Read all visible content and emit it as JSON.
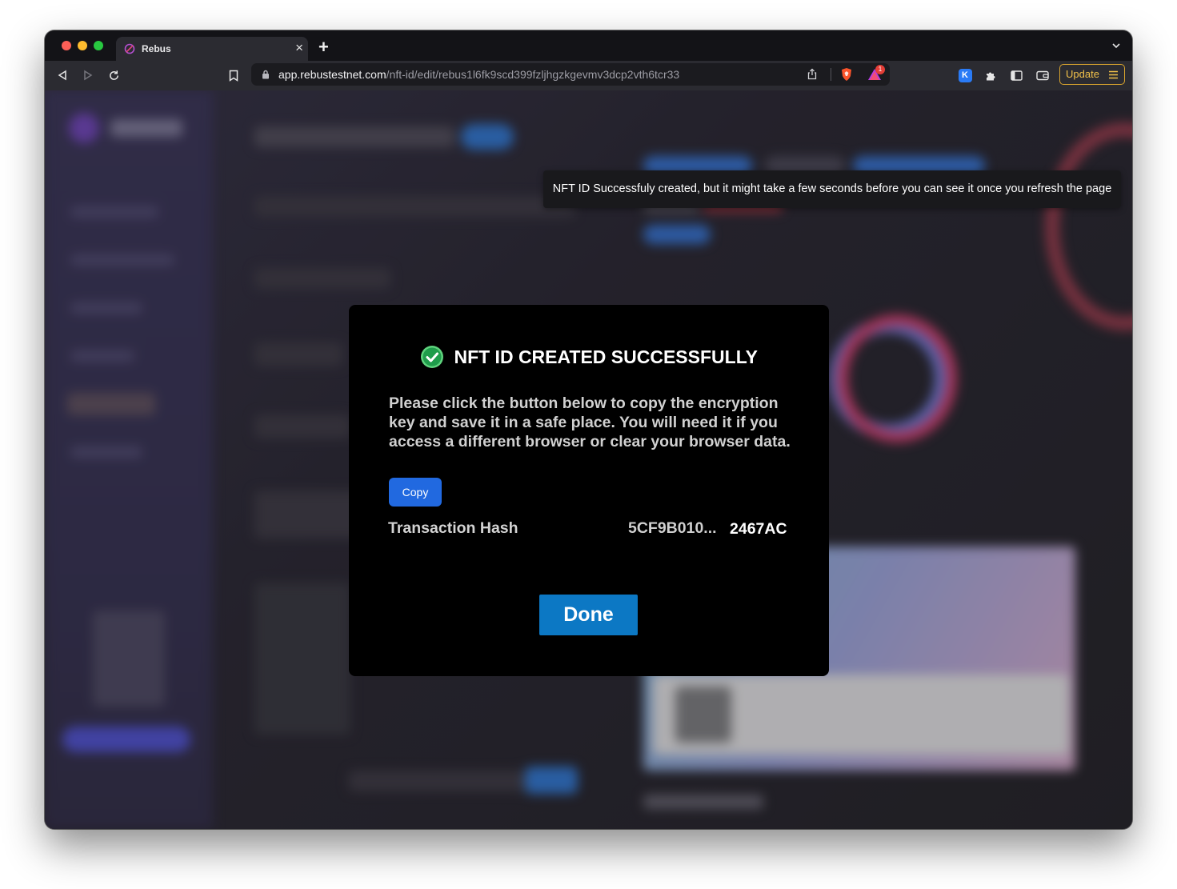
{
  "browser": {
    "tab_title": "Rebus",
    "url_host": "app.rebustestnet.com",
    "url_path": "/nft-id/edit/rebus1l6fk9scd399fzljhgzkgevmv3dcp2vth6tcr33",
    "update_label": "Update",
    "notification_count": "1",
    "extension_k_label": "K"
  },
  "toast": {
    "message": "NFT ID Successfuly created, but it might take a few seconds before you can see it once you refresh the page"
  },
  "modal": {
    "title": "NFT ID CREATED SUCCESSFULLY",
    "description": "Please click the button below to copy the encryption key and save it in a safe place. You will need it if you access a different browser or clear your browser data.",
    "copy_label": "Copy",
    "hash_label": "Transaction Hash",
    "hash_prefix": "5CF9B010...",
    "hash_suffix": "2467AC",
    "done_label": "Done"
  },
  "colors": {
    "accent_blue": "#2169e0",
    "done_blue": "#0c78c4",
    "success_green": "#5fd37d",
    "update_gold": "#d7a32e"
  }
}
